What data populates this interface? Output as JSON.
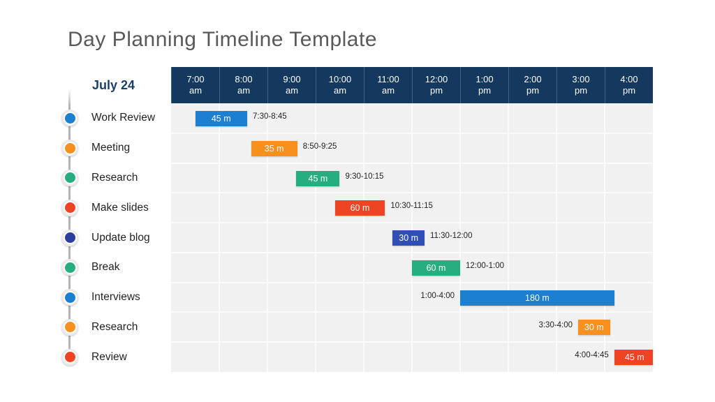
{
  "title": "Day Planning Timeline Template",
  "date_heading": "July 24",
  "colors": {
    "header_bg": "#15395e",
    "grid_bg": "#f1f1f1",
    "title_text": "#58595b",
    "date_text": "#1b4066",
    "blue": "#1d7fd0",
    "orange": "#f7901e",
    "green": "#27ae80",
    "red": "#ef4423",
    "navy": "#2f4fb5"
  },
  "time_columns": [
    {
      "hour": "7:00",
      "meridiem": "am"
    },
    {
      "hour": "8:00",
      "meridiem": "am"
    },
    {
      "hour": "9:00",
      "meridiem": "am"
    },
    {
      "hour": "10:00",
      "meridiem": "am"
    },
    {
      "hour": "11:00",
      "meridiem": "am"
    },
    {
      "hour": "12:00",
      "meridiem": "pm"
    },
    {
      "hour": "1:00",
      "meridiem": "pm"
    },
    {
      "hour": "2:00",
      "meridiem": "pm"
    },
    {
      "hour": "3:00",
      "meridiem": "pm"
    },
    {
      "hour": "4:00",
      "meridiem": "pm"
    }
  ],
  "tasks": [
    {
      "label": "Work Review",
      "dot_color": "#1d7fd0",
      "bar_color": "#1d7fd0",
      "duration_label": "45 m",
      "time_range": "7:30-8:45",
      "start_col": 0.5,
      "span_cols": 1.08,
      "label_side": "right"
    },
    {
      "label": "Meeting",
      "dot_color": "#f7901e",
      "bar_color": "#f7901e",
      "duration_label": "35 m",
      "time_range": "8:50-9:25",
      "start_col": 1.66,
      "span_cols": 0.96,
      "label_side": "right"
    },
    {
      "label": "Research",
      "dot_color": "#27ae80",
      "bar_color": "#27ae80",
      "duration_label": "45 m",
      "time_range": "9:30-10:15",
      "start_col": 2.6,
      "span_cols": 0.9,
      "label_side": "right"
    },
    {
      "label": "Make slides",
      "dot_color": "#ef4423",
      "bar_color": "#ef4423",
      "duration_label": "60 m",
      "time_range": "10:30-11:15",
      "start_col": 3.4,
      "span_cols": 1.04,
      "label_side": "right"
    },
    {
      "label": "Update blog",
      "dot_color": "#2c3e9e",
      "bar_color": "#2f4fb5",
      "duration_label": "30 m",
      "time_range": "11:30-12:00",
      "start_col": 4.6,
      "span_cols": 0.66,
      "label_side": "right"
    },
    {
      "label": "Break",
      "dot_color": "#27ae80",
      "bar_color": "#27ae80",
      "duration_label": "60 m",
      "time_range": "12:00-1:00",
      "start_col": 5.0,
      "span_cols": 1.0,
      "label_side": "right"
    },
    {
      "label": "Interviews",
      "dot_color": "#1d7fd0",
      "bar_color": "#1d7fd0",
      "duration_label": "180 m",
      "time_range": "1:00-4:00",
      "start_col": 6.0,
      "span_cols": 3.2,
      "label_side": "left"
    },
    {
      "label": "Research",
      "dot_color": "#f7901e",
      "bar_color": "#f7901e",
      "duration_label": "30 m",
      "time_range": "3:30-4:00",
      "start_col": 8.45,
      "span_cols": 0.66,
      "label_side": "left"
    },
    {
      "label": "Review",
      "dot_color": "#ef4423",
      "bar_color": "#ef4423",
      "duration_label": "45 m",
      "time_range": "4:00-4:45",
      "start_col": 9.2,
      "span_cols": 0.84,
      "label_side": "left"
    }
  ]
}
